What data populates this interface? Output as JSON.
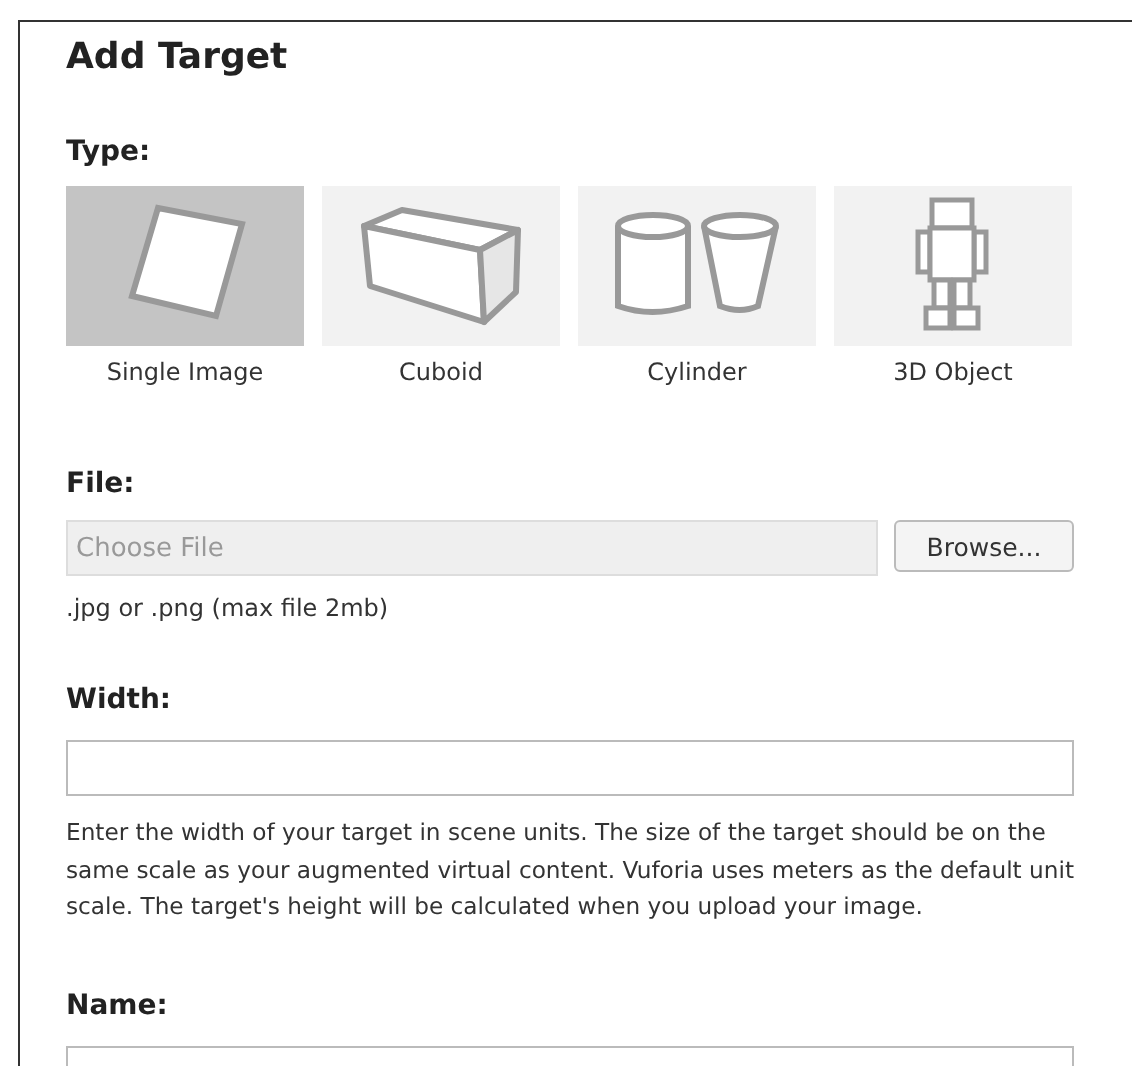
{
  "dialog": {
    "title": "Add Target"
  },
  "type_section": {
    "label": "Type:",
    "options": [
      {
        "label": "Single Image",
        "kind": "image",
        "selected": true
      },
      {
        "label": "Cuboid",
        "kind": "cuboid",
        "selected": false
      },
      {
        "label": "Cylinder",
        "kind": "cylinder",
        "selected": false
      },
      {
        "label": "3D Object",
        "kind": "object",
        "selected": false
      }
    ]
  },
  "file_section": {
    "label": "File:",
    "placeholder": "Choose File",
    "button": "Browse...",
    "hint": ".jpg or .png (max file 2mb)"
  },
  "width_section": {
    "label": "Width:",
    "help": "Enter the width of your target in scene units. The size of the target should be on the same scale as your augmented virtual content. Vuforia uses meters as the default unit scale. The target's height will be calculated when you upload your image."
  },
  "name_section": {
    "label": "Name:"
  }
}
